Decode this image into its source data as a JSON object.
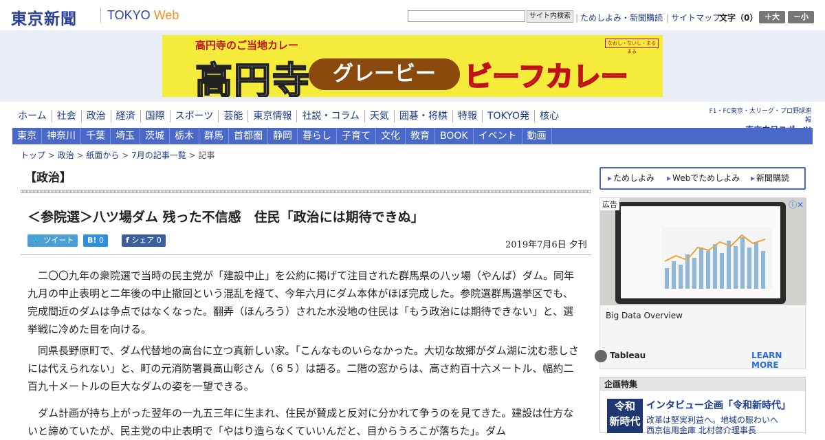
{
  "header": {
    "logo_jp": "東京新聞",
    "logo_tokyo": "TOKYO ",
    "logo_web": "Web",
    "search_placeholder": "",
    "search_button": "サイト内検索",
    "links": [
      "ためしよみ・新聞購読",
      "サイトマップ"
    ],
    "moji": "文字（0）",
    "font_up": "＋大",
    "font_down": "－小"
  },
  "banner": {
    "top": "高円寺のご当地カレー",
    "big": "高円寺",
    "pill": "グレービー",
    "curry": "ビーフカレー",
    "stamp": "なおし・ないし・まるまる"
  },
  "nav_primary": [
    "ホーム",
    "社会",
    "政治",
    "経済",
    "国際",
    "スポーツ",
    "芸能",
    "東京情報",
    "社説・コラム",
    "天気",
    "囲碁・将棋",
    "特報",
    "TOKYO発",
    "核心"
  ],
  "chunichi": {
    "small": "F1・FC東京・大リーグ・プロ野球速報",
    "brand": "東京中日スポーツ"
  },
  "nav_secondary": [
    "東京",
    "神奈川",
    "千葉",
    "埼玉",
    "茨城",
    "栃木",
    "群馬",
    "首都圏",
    "静岡",
    "暮らし",
    "子育て",
    "文化",
    "教育",
    "BOOK",
    "イベント",
    "動画"
  ],
  "breadcrumb": {
    "items": [
      "トップ",
      "政治",
      "紙面から",
      "7月の記事一覧"
    ],
    "current": "記事"
  },
  "article": {
    "section": "【政治】",
    "title": "＜参院選＞八ツ場ダム 残った不信感　住民「政治には期待できぬ」",
    "tweet": "ツイート",
    "hatena": "0",
    "share": "シェア 0",
    "date": "2019年7月6日 夕刊",
    "paragraphs": [
      "二〇〇九年の衆院選で当時の民主党が「建設中止」を公約に掲げて注目された群馬県の八ッ場（やんば）ダム。同年九月の中止表明と二年後の中止撤回という混乱を経て、今年六月にダム本体がほぼ完成した。参院選群馬選挙区でも、完成間近のダムは争点ではなくなった。翻弄（ほんろう）された水没地の住民は「もう政治には期待できない」と、選挙戦に冷めた目を向ける。",
      "同県長野原町で、ダム代替地の高台に立つ真新しい家。「こんなものいらなかった。大切な故郷がダム湖に沈む悲しさには代えられない」と、町の元消防署員高山彰さん（６５）は語る。二階の窓からは、高さ約百十六メートル、幅約二百九十メートルの巨大なダムの姿を一望できる。",
      "ダム計画が持ち上がった翌年の一九五三年に生まれ、住民が賛成と反対に分かれて争うのを見てきた。建設は仕方ないと諦めていたが、民主党の中止表明で「やはり造らなくていいんだと、目からうろこが落ちた」。ダム"
    ]
  },
  "sidebar": {
    "buttons": [
      "ためしよみ",
      "Webでためしよみ",
      "新聞購読"
    ],
    "ad": {
      "label": "広告",
      "info": "ⓘ✕",
      "title": "Big Data Overview",
      "brand": "Tableau",
      "more": "LEARN MORE"
    },
    "kikaku": {
      "heading": "企画特集",
      "thumb_line1": "令和",
      "thumb_line2": "新時代",
      "title": "インタビュー企画「令和新時代」",
      "line1": "改革は堅実利益へ。地域の賑わいへ",
      "line2": "西京信用金庫 北村啓介理事長"
    }
  }
}
